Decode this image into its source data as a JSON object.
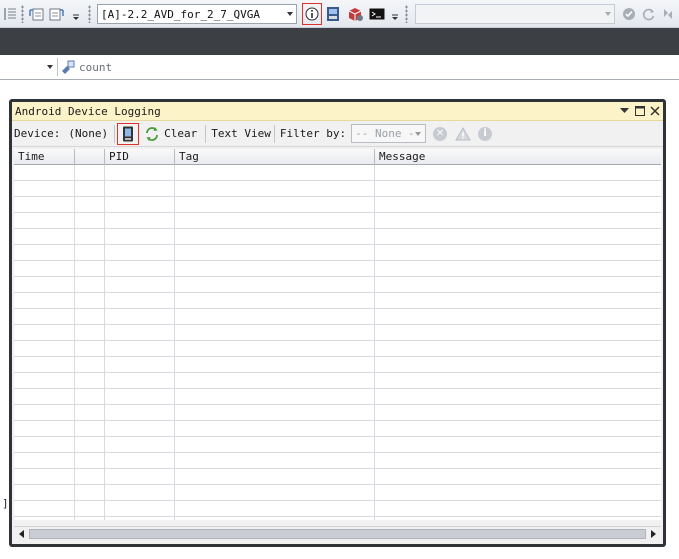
{
  "toolbar": {
    "avd_selected": "[A]-2.2_AVD_for_2_7_QVGA",
    "right_combo_value": ""
  },
  "member_bar": {
    "member_value": "count"
  },
  "logging_window": {
    "title": "Android Device Logging",
    "device_label": "Device:",
    "device_value": "(None)",
    "clear_label": "Clear",
    "text_view_label": "Text View",
    "filter_label": "Filter by:",
    "filter_value": "-- None -",
    "columns": [
      "Time",
      "",
      "PID",
      "Tag",
      "Message"
    ]
  },
  "stray_text": "]",
  "colors": {
    "title_bar": "#fdf3c8",
    "dark_band": "#3c3f44",
    "highlight": "#e0312b"
  }
}
